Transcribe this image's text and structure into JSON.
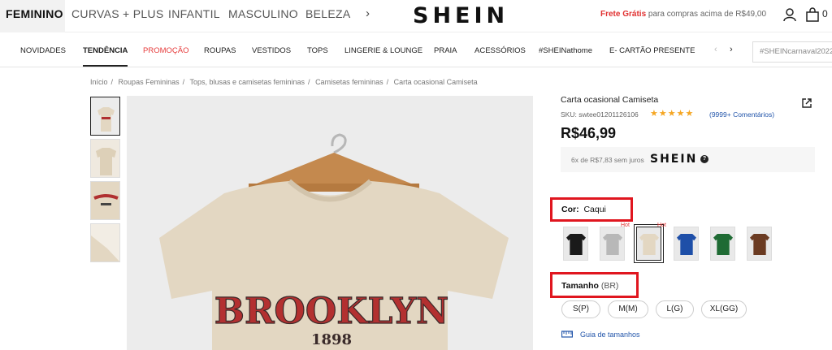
{
  "categories": [
    "FEMININO",
    "CURVAS + PLUS",
    "INFANTIL",
    "MASCULINO",
    "BELEZA"
  ],
  "logo": "SHEIN",
  "shipping": {
    "highlight": "Frete Grátis",
    "text": "para compras acima de R$49,00"
  },
  "cart_count": "0",
  "nav": [
    "NOVIDADES",
    "TENDÊNCIA",
    "PROMOÇÃO",
    "ROUPAS",
    "VESTIDOS",
    "TOPS",
    "LINGERIE & LOUNGE",
    "PRAIA",
    "ACESSÓRIOS",
    "#SHEINathome",
    "E- CARTÃO PRESENTE"
  ],
  "search_term": "#SHEINcarnaval2022",
  "breadcrumbs": [
    "Início",
    "Roupas Femininas",
    "Tops, blusas e camisetas femininas",
    "Camisetas femininas",
    "Carta ocasional Camiseta"
  ],
  "product": {
    "title": "Carta ocasional Camiseta",
    "sku": "SKU: swtee01201126106",
    "stars": "★★★★★",
    "reviews": "(9999+ Comentários)",
    "price": "R$46,99",
    "installments": "6x de R$7,83 sem juros",
    "installment_logo": "SHEIN",
    "image_text": {
      "line1": "BROOKLYN",
      "line2": "1898"
    }
  },
  "color": {
    "label": "Cor:",
    "value": "Caqui",
    "hot_badge": "Hot"
  },
  "swatches": [
    {
      "name": "Preto",
      "color": "#1a1a1a",
      "hot": false
    },
    {
      "name": "Cinza",
      "color": "#b8b8b8",
      "hot": true
    },
    {
      "name": "Caqui",
      "color": "#e3d7c2",
      "hot": true,
      "selected": true
    },
    {
      "name": "Azul",
      "color": "#1e4fa8",
      "hot": false
    },
    {
      "name": "Verde",
      "color": "#1f6b34",
      "hot": false
    },
    {
      "name": "Marrom",
      "color": "#6b3b22",
      "hot": false
    }
  ],
  "size": {
    "label": "Tamanho",
    "unit": "(BR)",
    "options": [
      "S(P)",
      "M(M)",
      "L(G)",
      "XL(GG)"
    ]
  },
  "size_guide": "Guia de tamanhos"
}
